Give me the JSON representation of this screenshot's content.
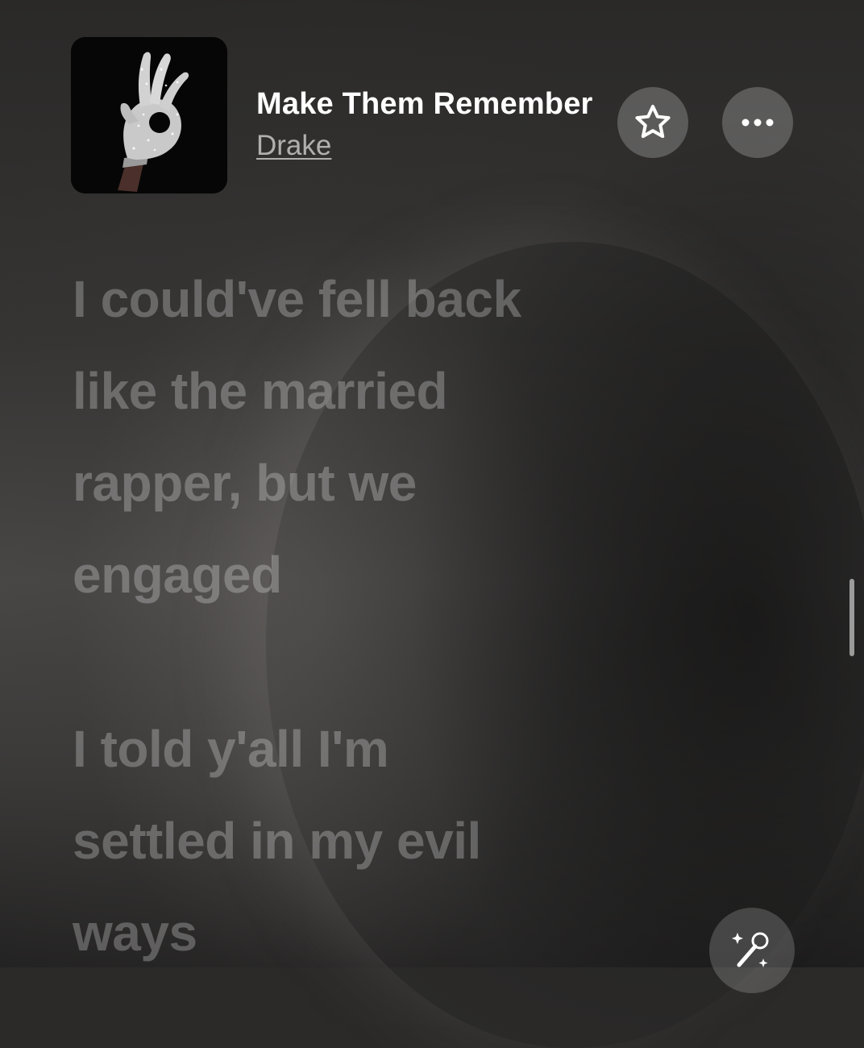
{
  "now_playing": {
    "title": "Make Them Remember",
    "artist": "Drake",
    "artwork_icon": "ok-hand-glove-artwork"
  },
  "actions": {
    "favorite_icon": "star-icon",
    "more_icon": "ellipsis-icon",
    "sing_icon": "microphone-sparkle-icon"
  },
  "lyrics": {
    "stanza_1": [
      "I could've fell back",
      "like the married",
      "rapper, but we",
      "engaged"
    ],
    "stanza_2": [
      "I told y'all I'm",
      "settled in my evil",
      "ways"
    ]
  },
  "colors": {
    "background": "#2b2a29",
    "title": "#ffffff",
    "lyric_inactive": "rgba(255,255,255,0.26)"
  }
}
